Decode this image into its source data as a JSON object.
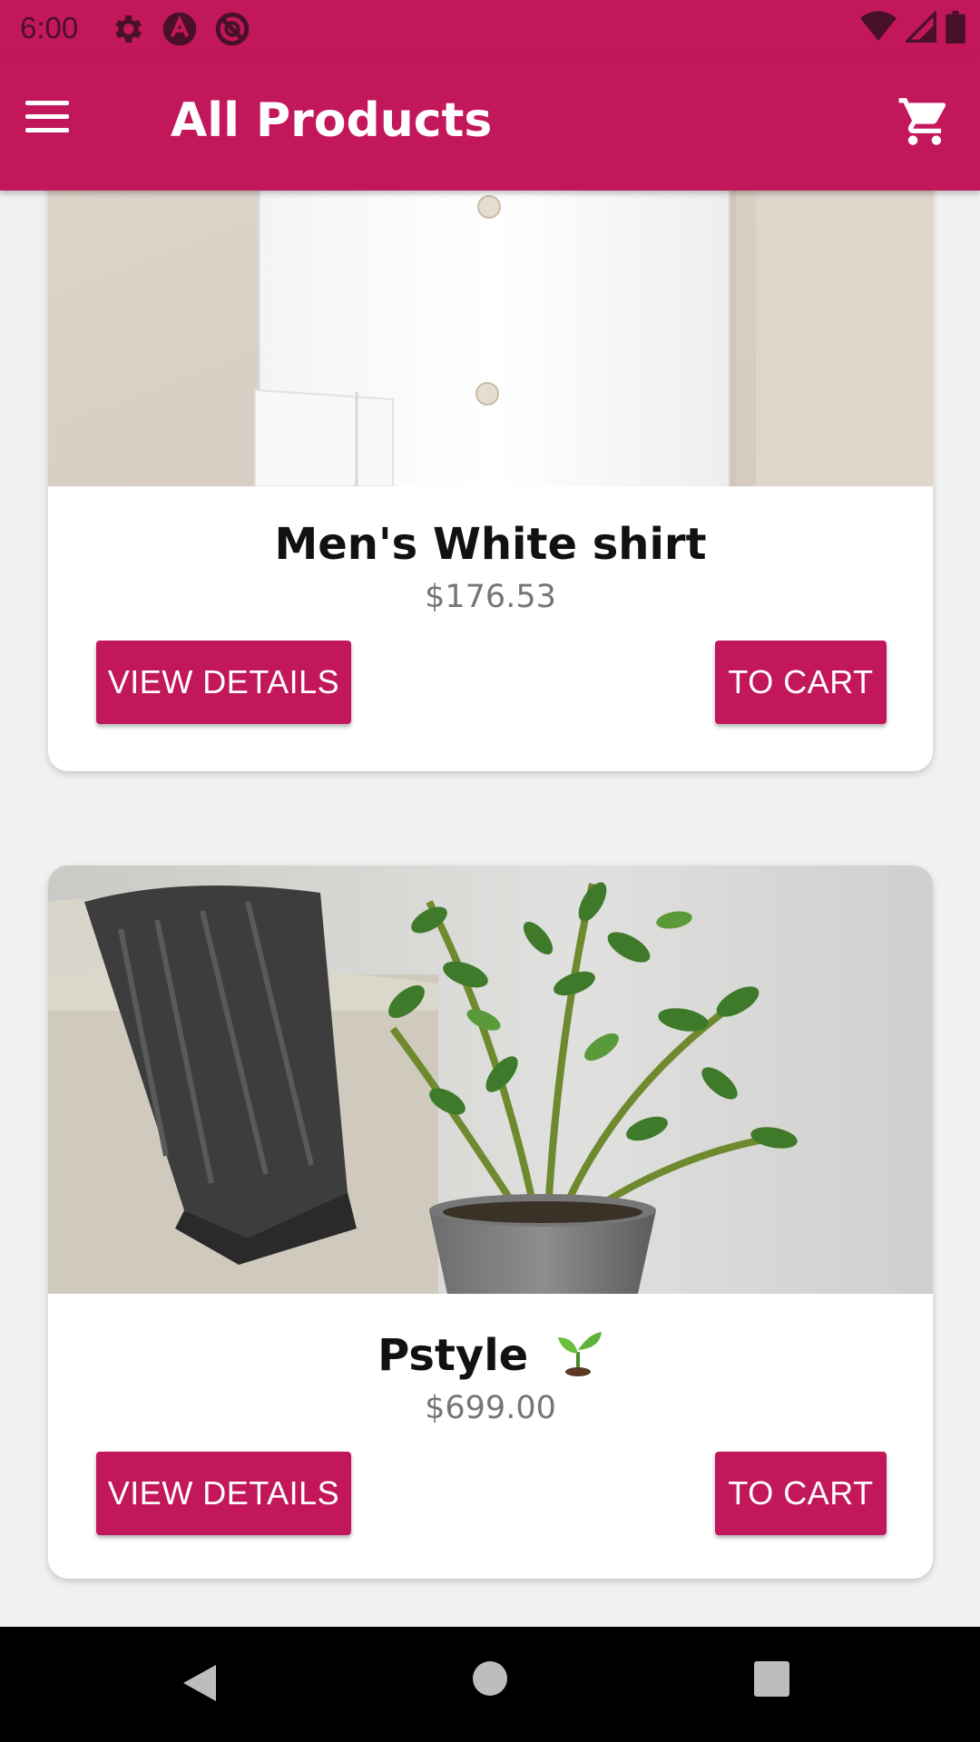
{
  "status_bar": {
    "time": "6:00",
    "icons": [
      "settings-gear-icon",
      "app-a-icon",
      "no-tracking-icon",
      "wifi-icon",
      "signal-icon",
      "battery-icon"
    ]
  },
  "app_bar": {
    "title": "All Products",
    "menu_icon": "hamburger-menu-icon",
    "cart_icon": "shopping-cart-icon"
  },
  "products": [
    {
      "name": "Men's White shirt",
      "price": "$176.53",
      "image": "white-dress-shirt-photo",
      "details_label": "VIEW DETAILS",
      "cart_label": "TO CART"
    },
    {
      "name": "Pstyle",
      "name_icon": "seedling-emoji",
      "price": "$699.00",
      "image": "potted-plant-and-throw-photo",
      "details_label": "VIEW DETAILS",
      "cart_label": "TO CART"
    }
  ],
  "nav_bar": {
    "buttons": [
      "back-icon",
      "home-icon",
      "recents-icon"
    ]
  },
  "colors": {
    "primary": "#c2185b",
    "background": "#f1f1f1",
    "card": "#ffffff",
    "price_text": "#757575"
  }
}
